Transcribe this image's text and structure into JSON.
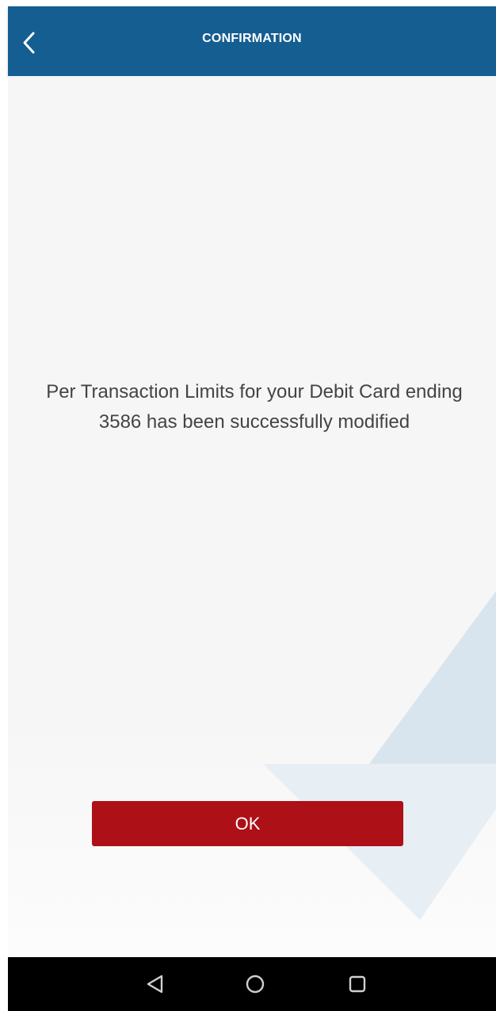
{
  "header": {
    "title": "CONFIRMATION",
    "back_icon": "chevron-left-icon",
    "background_color": "#155e91"
  },
  "confirmation": {
    "message_line1": "Per Transaction Limits for your Debit Card ending",
    "message_line2": "3586 has been successfully modified"
  },
  "actions": {
    "ok_label": "OK",
    "ok_color": "#ad1016"
  },
  "system_nav": {
    "back_icon": "triangle-back-icon",
    "home_icon": "circle-home-icon",
    "recents_icon": "square-recents-icon"
  }
}
